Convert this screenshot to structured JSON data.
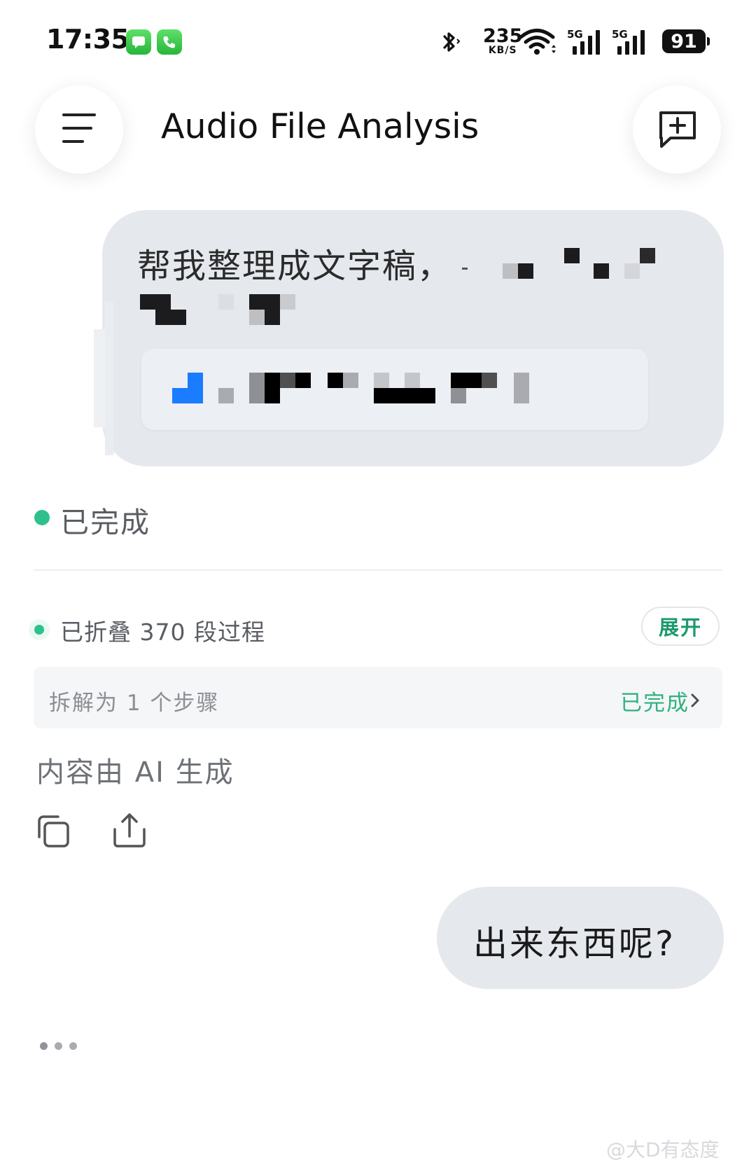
{
  "status_bar": {
    "time": "17:35",
    "speed_value": "235",
    "speed_unit": "KB/S",
    "network_1": "5G",
    "network_2": "5G",
    "battery": "91"
  },
  "header": {
    "title": "Audio File Analysis",
    "menu_icon": "menu-icon",
    "new_chat_icon": "new-chat-icon"
  },
  "messages": {
    "user_1_text": "帮我整理成文字稿，",
    "status_done": "已完成",
    "folded_text": "已折叠 370 段过程",
    "expand_label": "展开",
    "step_text": "拆解为 1 个步骤",
    "step_status": "已完成",
    "ai_note": "内容由 AI 生成",
    "user_2_text": "出来东西呢?"
  },
  "watermark": "@大D有态度",
  "colors": {
    "accent_green": "#2fc18b",
    "bubble_bg": "#e5e8ed",
    "file_icon_blue": "#1a7cff"
  }
}
